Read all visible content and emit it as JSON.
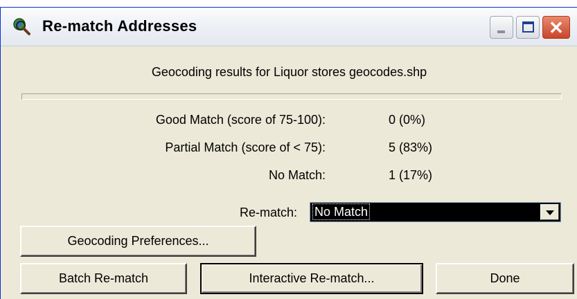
{
  "window": {
    "title": "Re-match Addresses",
    "icon": "globe-magnifier-icon",
    "controls": {
      "minimize": "minimize-icon",
      "maximize": "maximize-icon",
      "close": "close-icon"
    },
    "colors": {
      "frame_blue": "#0831d9",
      "close_red": "#c8452b",
      "background": "#ece9d8"
    }
  },
  "caption": "Geocoding results for Liquor stores geocodes.shp",
  "stats": [
    {
      "label": "Good Match (score of 75-100):",
      "value": "0 (0%)"
    },
    {
      "label": "Partial Match (score of < 75):",
      "value": "5 (83%)"
    },
    {
      "label": "No Match:",
      "value": "1 (17%)"
    }
  ],
  "rematch": {
    "label": "Re-match:",
    "selected": "No Match"
  },
  "buttons": {
    "preferences": "Geocoding Preferences...",
    "batch": "Batch Re-match",
    "interactive": "Interactive Re-match...",
    "done": "Done"
  }
}
